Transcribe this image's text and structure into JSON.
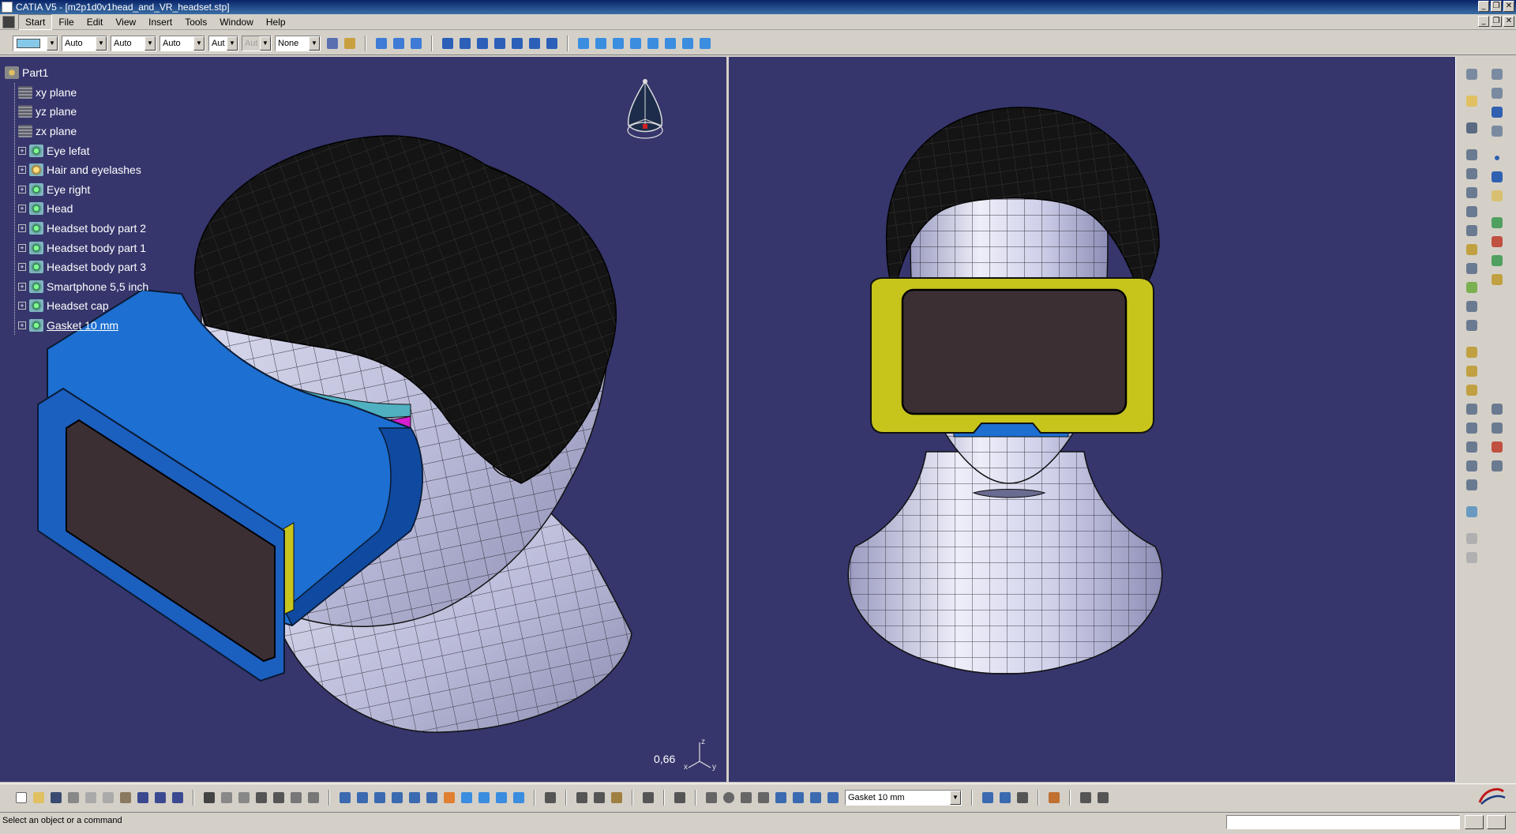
{
  "window": {
    "title": "CATIA V5 - [m2p1d0v1head_and_VR_headset.stp]",
    "buttons": {
      "minimize": "_",
      "restore": "❐",
      "close": "✕"
    }
  },
  "menu": {
    "items": [
      "Start",
      "File",
      "Edit",
      "View",
      "Insert",
      "Tools",
      "Window",
      "Help"
    ],
    "active": "Start"
  },
  "toolbar_top": {
    "color_combo": "",
    "transparency": "Auto",
    "line_thickness": "Auto",
    "line_type": "Auto",
    "point_symbol": "Aut",
    "rendering_style": "Aut",
    "layer": "None"
  },
  "spec_tree": {
    "root": "Part1",
    "planes": [
      "xy plane",
      "yz plane",
      "zx plane"
    ],
    "bodies": [
      "Eye lefat",
      "Hair and eyelashes",
      "Eye right",
      "Head",
      "Headset body part 2",
      "Headset body part 1",
      "Headset body part 3",
      "Smartphone 5,5 inch",
      "Headset cap",
      "Gasket 10 mm"
    ]
  },
  "viewport": {
    "zoom_level": "0,66",
    "axis": {
      "z": "z",
      "x": "x",
      "y": "y"
    }
  },
  "toolbar_bottom": {
    "current_body": "Gasket 10 mm"
  },
  "status": {
    "message": "Select an object or a command",
    "command_input": ""
  },
  "colors": {
    "viewport_bg": "#36366d",
    "headset_blue": "#1d6fd1",
    "headset_yellow": "#c7c51c",
    "gasket_magenta": "#d61fd1",
    "screen_dark": "#3b2f34",
    "skin": "#c7c8e6",
    "hair": "#1a1a1a"
  },
  "icons": {
    "compass": "compass-icon",
    "tree_root": "part-icon",
    "plane": "plane-icon",
    "body": "body-icon"
  }
}
